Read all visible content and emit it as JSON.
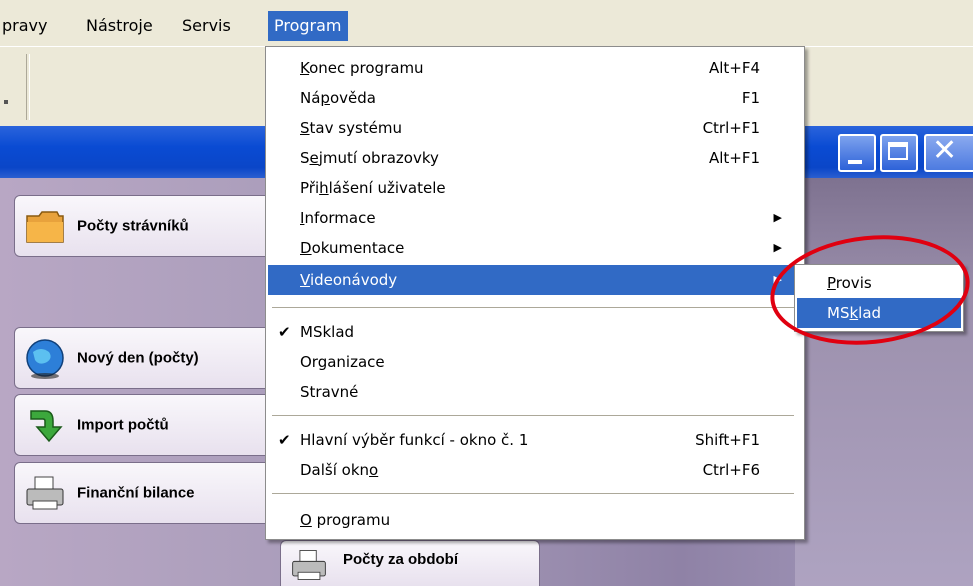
{
  "menubar": {
    "items": [
      "pravy",
      "Nástroje",
      "Servis",
      "Program"
    ]
  },
  "left_buttons": [
    {
      "label": "Počty strávníků",
      "icon": "folder-icon"
    },
    {
      "label": "Nový den (počty)",
      "icon": "globe-icon"
    },
    {
      "label": "Import počtů",
      "icon": "import-arrow-icon"
    },
    {
      "label": "Finanční bilance",
      "icon": "printer-icon"
    }
  ],
  "bottom_button": {
    "label": "Počty za období",
    "icon": "printer-icon"
  },
  "program_menu": {
    "konec": {
      "pre": "",
      "u": "K",
      "post": "onec programu",
      "shortcut": "Alt+F4"
    },
    "napoveda": {
      "pre": "Ná",
      "u": "p",
      "post": "ověda",
      "shortcut": "F1"
    },
    "stav": {
      "pre": "",
      "u": "S",
      "post": "tav systému",
      "shortcut": "Ctrl+F1"
    },
    "sejmuti": {
      "pre": "S",
      "u": "e",
      "post": "jmutí obrazovky",
      "shortcut": "Alt+F1"
    },
    "prihlaseni": {
      "pre": "Při",
      "u": "h",
      "post": "lášení uživatele"
    },
    "informace": {
      "pre": "",
      "u": "I",
      "post": "nformace"
    },
    "dokumentace": {
      "pre": "",
      "u": "D",
      "post": "okumentace"
    },
    "videonavody": {
      "pre": "",
      "u": "V",
      "post": "ideonávody"
    },
    "msklad": {
      "label": "MSklad",
      "checked": true
    },
    "organizace": {
      "label": "Organizace"
    },
    "stravne": {
      "label": "Stravné"
    },
    "hlavni": {
      "label": "Hlavní výběr funkcí - okno č. 1",
      "shortcut": "Shift+F1",
      "checked": true
    },
    "dalsi": {
      "pre": "Další okn",
      "u": "o",
      "post": "",
      "shortcut": "Ctrl+F6"
    },
    "oprogramu": {
      "pre": "",
      "u": "O",
      "post": " programu"
    }
  },
  "submenu": {
    "provis": {
      "pre": "",
      "u": "P",
      "post": "rovis"
    },
    "msklad": {
      "pre": "MS",
      "u": "k",
      "post": "lad"
    }
  },
  "colors": {
    "highlight": "#316ac5",
    "annotation": "#e00010",
    "menubar": "#ece9d8"
  }
}
